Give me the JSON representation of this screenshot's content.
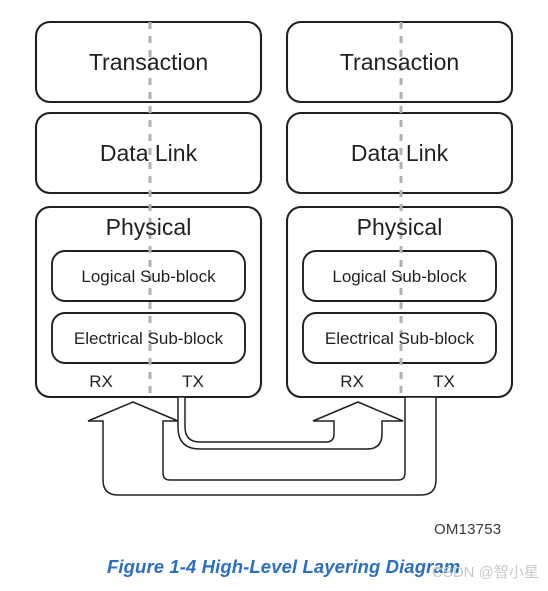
{
  "figure": {
    "caption": "Figure  1-4  High-Level Layering Diagram",
    "caption_color": "#2a6fc0",
    "code": "OM13753",
    "watermark": "CSDN @智小星",
    "watermark_color": "#c9c9c9",
    "background": "#ffffff",
    "stroke_color": "#231f20",
    "divider_color": "#b0b0b0"
  },
  "devices": [
    {
      "id": "left-device",
      "layers": [
        {
          "name": "transaction",
          "label": "Transaction"
        },
        {
          "name": "data-link",
          "label": "Data Link"
        },
        {
          "name": "physical",
          "label": "Physical"
        }
      ],
      "sub_blocks": [
        {
          "name": "logical-sub-block",
          "label": "Logical Sub-block"
        },
        {
          "name": "electrical-sub-block",
          "label": "Electrical Sub-block"
        }
      ],
      "ports": [
        {
          "name": "rx",
          "label": "RX"
        },
        {
          "name": "tx",
          "label": "TX"
        }
      ]
    },
    {
      "id": "right-device",
      "layers": [
        {
          "name": "transaction",
          "label": "Transaction"
        },
        {
          "name": "data-link",
          "label": "Data Link"
        },
        {
          "name": "physical",
          "label": "Physical"
        }
      ],
      "sub_blocks": [
        {
          "name": "logical-sub-block",
          "label": "Logical Sub-block"
        },
        {
          "name": "electrical-sub-block",
          "label": "Electrical Sub-block"
        }
      ],
      "ports": [
        {
          "name": "rx",
          "label": "RX"
        },
        {
          "name": "tx",
          "label": "TX"
        }
      ]
    }
  ],
  "links": [
    {
      "name": "left-tx-to-right-rx",
      "from": "left-device.tx",
      "to": "right-device.rx"
    },
    {
      "name": "right-tx-to-left-rx",
      "from": "right-device.tx",
      "to": "left-device.rx"
    }
  ]
}
